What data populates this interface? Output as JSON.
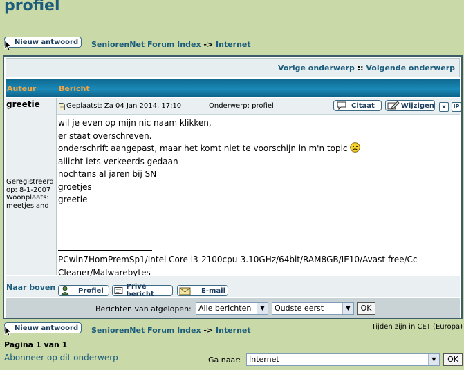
{
  "page": {
    "title": "profiel"
  },
  "actions": {
    "new_reply": "Nieuw antwoord"
  },
  "breadcrumb": {
    "forum_index": "SeniorenNet Forum Index",
    "separator": "->",
    "forum": "Internet"
  },
  "topic_nav": {
    "previous": "Vorige onderwerp",
    "separator": "::",
    "next": "Volgende onderwerp"
  },
  "table_headers": {
    "author": "Auteur",
    "message": "Bericht"
  },
  "post": {
    "author": "greetie",
    "author_details": [
      "Geregistreerd",
      "op: 8-1-2007",
      "Woonplaats:",
      "meetjesland"
    ],
    "posted": "Geplaatst: Za 04 Jan 2014, 17:10",
    "subject": "Onderwerp: profiel",
    "buttons": {
      "quote": "Citaat",
      "edit": "Wijzigen",
      "delete": "x",
      "ip": "IP"
    },
    "lines": [
      "wil je even op mijn nic naam klikken,",
      "er staat overschreven.",
      "onderschrift aangepast, maar het komt niet te voorschijn in m'n topic",
      "allicht iets verkeerds gedaan",
      "nochtans al jaren bij SN",
      "groetjes",
      "greetie"
    ],
    "signature": [
      "PCwin7HomPremSp1/Intel Core i3-2100cpu-3.10GHz/64bit/RAM8GB/IE10/Avast free/Cc",
      "Cleaner/Malwarebytes"
    ]
  },
  "post_footer": {
    "back_to_top": "Naar boven",
    "profile": "Profiel",
    "pm": "Prive bericht",
    "email": "E-mail"
  },
  "filter": {
    "label": "Berichten van afgelopen:",
    "period": "Alle berichten",
    "order": "Oudste eerst",
    "ok": "OK"
  },
  "timezone": "Tijden zijn in CET (Europa)",
  "pagination": "Pagina 1 van 1",
  "subscribe": "Abonneer op dit onderwerp",
  "jump": {
    "label": "Ga naar:",
    "value": "Internet",
    "ok": "OK"
  },
  "colors": {
    "page_bg": "#c9d9a8",
    "link": "#1b5c7c",
    "header_text": "#f3a443",
    "header_bg": "#1b8ab8"
  }
}
